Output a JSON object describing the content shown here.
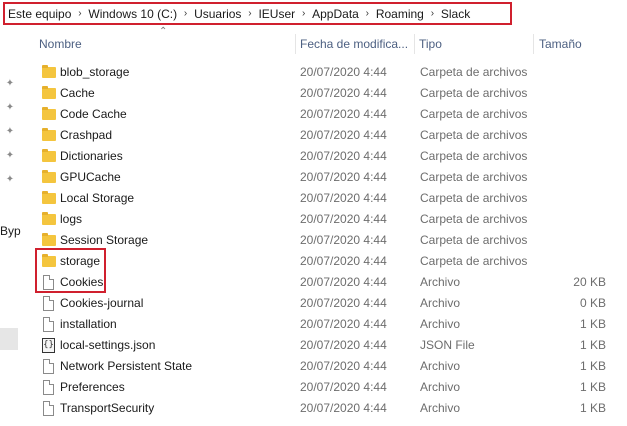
{
  "breadcrumb": [
    "Este equipo",
    "Windows 10 (C:)",
    "Usuarios",
    "IEUser",
    "AppData",
    "Roaming",
    "Slack"
  ],
  "nav": {
    "label": "Byp"
  },
  "columns": {
    "name": "Nombre",
    "date": "Fecha de modifica...",
    "type": "Tipo",
    "size": "Tamaño"
  },
  "files": [
    {
      "name": "blob_storage",
      "date": "20/07/2020 4:44",
      "type": "Carpeta de archivos",
      "size": "",
      "icon": "folder-icon"
    },
    {
      "name": "Cache",
      "date": "20/07/2020 4:44",
      "type": "Carpeta de archivos",
      "size": "",
      "icon": "folder-icon"
    },
    {
      "name": "Code Cache",
      "date": "20/07/2020 4:44",
      "type": "Carpeta de archivos",
      "size": "",
      "icon": "folder-icon"
    },
    {
      "name": "Crashpad",
      "date": "20/07/2020 4:44",
      "type": "Carpeta de archivos",
      "size": "",
      "icon": "folder-icon"
    },
    {
      "name": "Dictionaries",
      "date": "20/07/2020 4:44",
      "type": "Carpeta de archivos",
      "size": "",
      "icon": "folder-icon"
    },
    {
      "name": "GPUCache",
      "date": "20/07/2020 4:44",
      "type": "Carpeta de archivos",
      "size": "",
      "icon": "folder-icon"
    },
    {
      "name": "Local Storage",
      "date": "20/07/2020 4:44",
      "type": "Carpeta de archivos",
      "size": "",
      "icon": "folder-icon"
    },
    {
      "name": "logs",
      "date": "20/07/2020 4:44",
      "type": "Carpeta de archivos",
      "size": "",
      "icon": "folder-icon"
    },
    {
      "name": "Session Storage",
      "date": "20/07/2020 4:44",
      "type": "Carpeta de archivos",
      "size": "",
      "icon": "folder-icon"
    },
    {
      "name": "storage",
      "date": "20/07/2020 4:44",
      "type": "Carpeta de archivos",
      "size": "",
      "icon": "folder-icon"
    },
    {
      "name": "Cookies",
      "date": "20/07/2020 4:44",
      "type": "Archivo",
      "size": "20 KB",
      "icon": "file-icon"
    },
    {
      "name": "Cookies-journal",
      "date": "20/07/2020 4:44",
      "type": "Archivo",
      "size": "0 KB",
      "icon": "file-icon"
    },
    {
      "name": "installation",
      "date": "20/07/2020 4:44",
      "type": "Archivo",
      "size": "1 KB",
      "icon": "file-icon"
    },
    {
      "name": "local-settings.json",
      "date": "20/07/2020 4:44",
      "type": "JSON File",
      "size": "1 KB",
      "icon": "json-file-icon"
    },
    {
      "name": "Network Persistent State",
      "date": "20/07/2020 4:44",
      "type": "Archivo",
      "size": "1 KB",
      "icon": "file-icon"
    },
    {
      "name": "Preferences",
      "date": "20/07/2020 4:44",
      "type": "Archivo",
      "size": "1 KB",
      "icon": "file-icon"
    },
    {
      "name": "TransportSecurity",
      "date": "20/07/2020 4:44",
      "type": "Archivo",
      "size": "1 KB",
      "icon": "file-icon"
    }
  ],
  "colors": {
    "highlight": "#d0202e",
    "folder": "#f4c53e",
    "header_text": "#4d6082"
  }
}
